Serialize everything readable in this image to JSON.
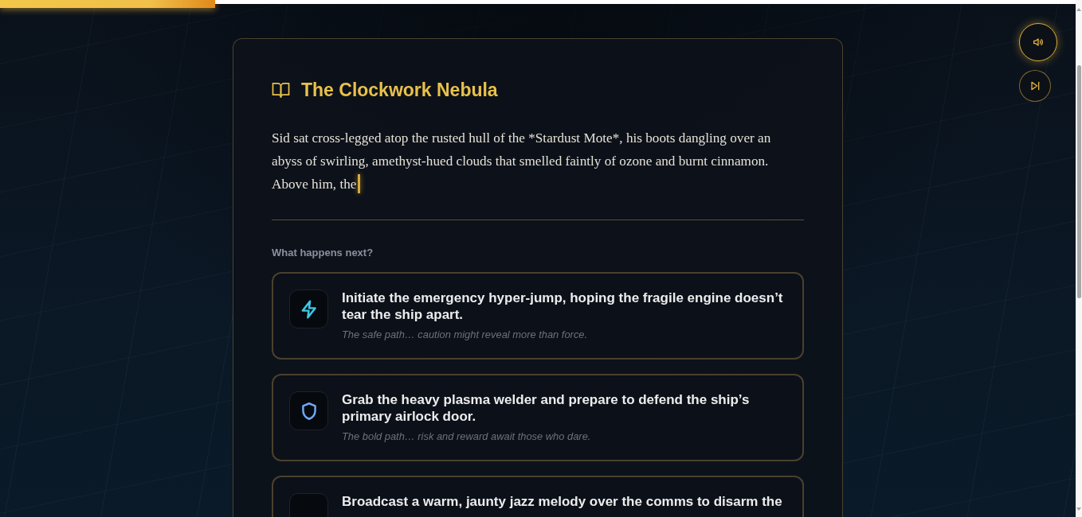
{
  "progress": {
    "level": 0.2
  },
  "controls": [
    {
      "kind": "sound",
      "active": true
    },
    {
      "kind": "skip",
      "active": false
    }
  ],
  "story": {
    "title": "The Clockwork Nebula",
    "text": "Sid sat cross-legged atop the rusted hull of the *Stardust Mote*, his boots dangling over an abyss of swirling, amethyst-hued clouds that smelled faintly of ozone and burnt cinnamon. Above him, the",
    "typing": true
  },
  "prompt": "What happens next?",
  "choices": [
    {
      "kind": "bolt",
      "color": "#3cc8e6",
      "title": "Initiate the emergency hyper-jump, hoping the fragile engine doesn’t tear the ship apart.",
      "hint": "The safe path… caution might reveal more than force."
    },
    {
      "kind": "shield",
      "color": "#6fa8f5",
      "title": "Grab the heavy plasma welder and prepare to defend the ship’s primary airlock door.",
      "hint": "The bold path… risk and reward await those who dare."
    },
    {
      "title": "Broadcast a warm, jaunty jazz melody over the comms to disarm the"
    }
  ]
}
